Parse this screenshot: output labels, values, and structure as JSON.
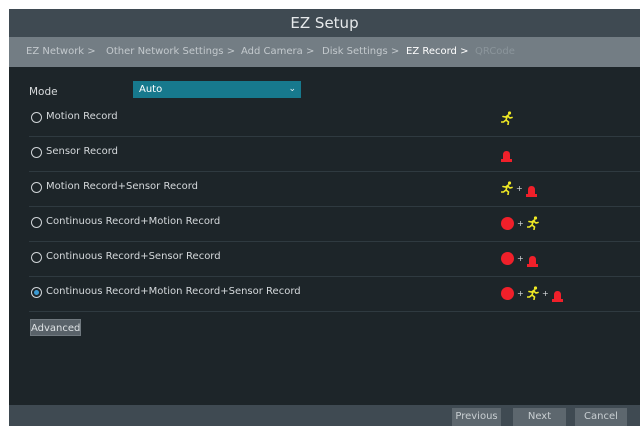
{
  "window": {
    "title": "EZ Setup"
  },
  "breadcrumbs": [
    {
      "label": "EZ Network >",
      "state": "done"
    },
    {
      "label": "Other Network Settings >",
      "state": "done"
    },
    {
      "label": "Add Camera >",
      "state": "done"
    },
    {
      "label": "Disk Settings >",
      "state": "done"
    },
    {
      "label": "EZ Record >",
      "state": "active"
    },
    {
      "label": "QRCode",
      "state": "pending"
    }
  ],
  "mode": {
    "label": "Mode",
    "value": "Auto"
  },
  "options": [
    {
      "label": "Motion Record",
      "selected": false,
      "icons": [
        "motion-icon"
      ]
    },
    {
      "label": "Sensor Record",
      "selected": false,
      "icons": [
        "sensor-alarm-icon"
      ]
    },
    {
      "label": "Motion Record+Sensor Record",
      "selected": false,
      "icons": [
        "motion-icon",
        "sensor-alarm-icon"
      ]
    },
    {
      "label": "Continuous Record+Motion Record",
      "selected": false,
      "icons": [
        "continuous-record-icon",
        "motion-icon"
      ]
    },
    {
      "label": "Continuous Record+Sensor Record",
      "selected": false,
      "icons": [
        "continuous-record-icon",
        "sensor-alarm-icon"
      ]
    },
    {
      "label": "Continuous Record+Motion Record+Sensor Record",
      "selected": true,
      "icons": [
        "continuous-record-icon",
        "motion-icon",
        "sensor-alarm-icon"
      ]
    }
  ],
  "icon_plus": "+",
  "advanced_label": "Advanced",
  "footer": {
    "previous_label": "Previous",
    "next_label": "Next",
    "cancel_label": "Cancel"
  },
  "colors": {
    "background": "#1d2529",
    "titlebar": "#3f4a52",
    "breadcrumb_bar": "#737d84",
    "select_accent": "#17798d",
    "radio_checked": "#3b9bd4",
    "motion_icon": "#f0ea24",
    "alarm_icon": "#f0202a"
  }
}
